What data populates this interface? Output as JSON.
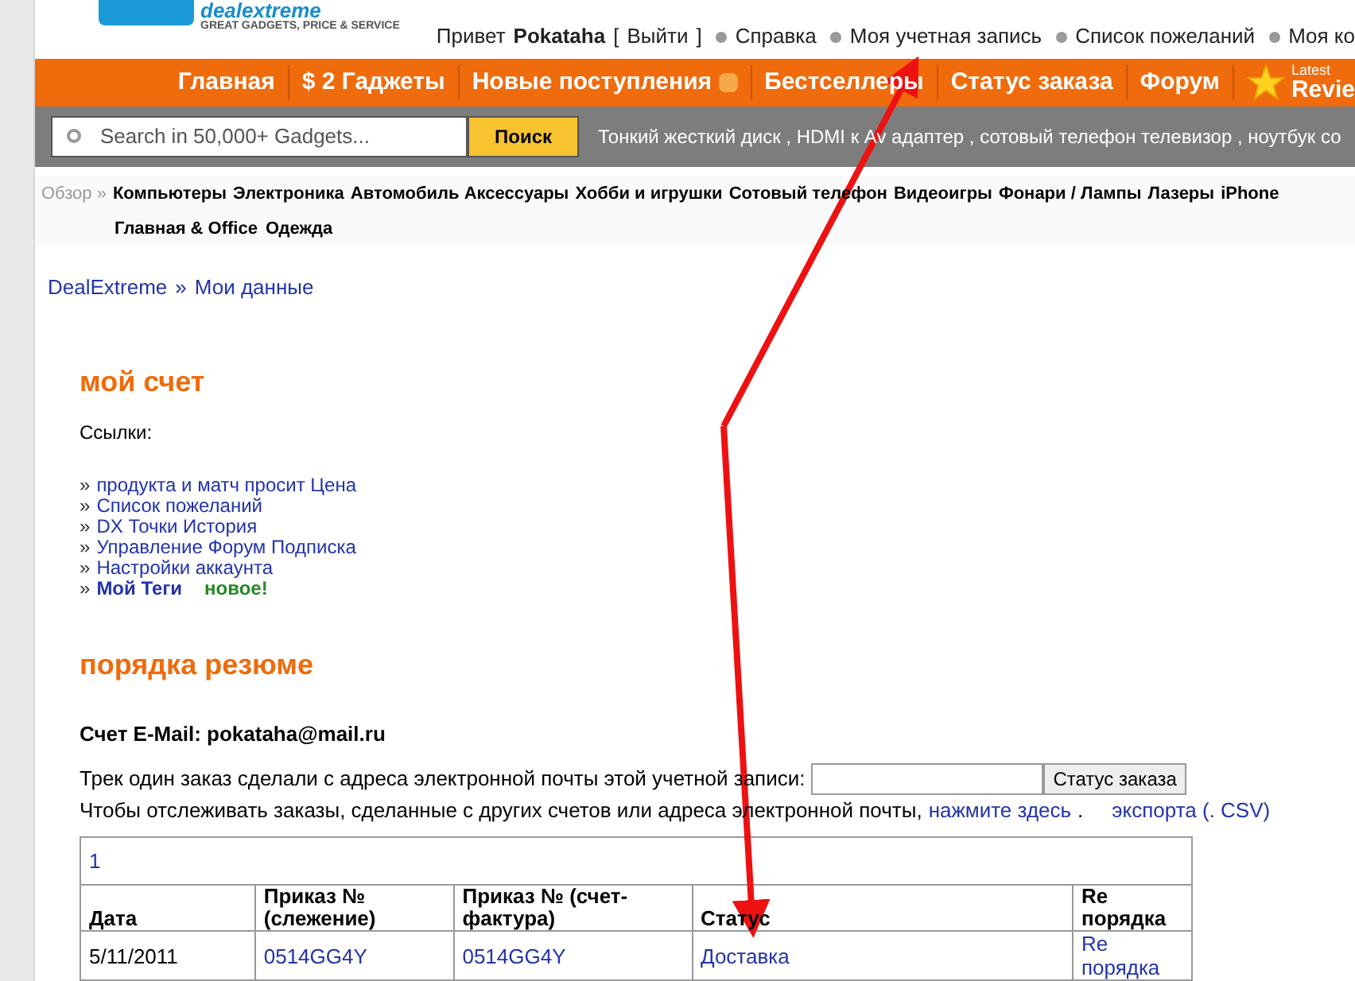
{
  "logo": {
    "brand": "dealextreme",
    "tagline": "GREAT GADGETS, PRICE & SERVICE"
  },
  "user_bar": {
    "greeting": "Привет",
    "username": "Pokataha",
    "logout_open": "[",
    "logout": "Выйти",
    "logout_close": "]",
    "links": [
      "Справка",
      "Моя учетная запись",
      "Список пожеланий",
      "Моя ко"
    ]
  },
  "nav": {
    "items": [
      {
        "label": "Главная",
        "kind": "text"
      },
      {
        "label": "$ 2 Гаджеты",
        "kind": "text"
      },
      {
        "label": "Новые поступления",
        "kind": "rss"
      },
      {
        "label": "Бестселлеры",
        "kind": "text"
      },
      {
        "label": "Статус заказа",
        "kind": "text"
      },
      {
        "label": "Форум",
        "kind": "text"
      }
    ],
    "reviews_top": "Latest",
    "reviews": "Revie"
  },
  "search": {
    "placeholder": "Search in 50,000+ Gadgets...",
    "button": "Поиск",
    "suggestions": "Тонкий жесткий диск , HDMI к Av адаптер , сотовый телефон телевизор , ноутбук со"
  },
  "categories": {
    "label": "Обзор »",
    "items": [
      "Компьютеры",
      "Электроника",
      "Автомобиль Аксессуары",
      "Хобби и игрушки",
      "Сотовый телефон",
      "Видеоигры",
      "Фонари / Лампы",
      "Лазеры",
      "iPhone",
      "Главная & Office",
      "Одежда"
    ]
  },
  "breadcrumb": [
    "DealExtreme",
    "»",
    "Мои данные"
  ],
  "account": {
    "title": "мой счет",
    "links_label": "Ссылки:",
    "links": [
      {
        "marker": "»",
        "label": "продукта и матч просит Цена",
        "bold": false
      },
      {
        "marker": "»",
        "label": "Список пожеланий",
        "bold": false
      },
      {
        "marker": "»",
        "label": "DX Точки История",
        "bold": false
      },
      {
        "marker": "»",
        "label": "Управление Форум Подписка",
        "bold": false
      },
      {
        "marker": "»",
        "label": "Настройки аккаунта",
        "bold": false
      },
      {
        "marker": "»",
        "label": "Мой Теги",
        "bold": true,
        "badge": "новое!"
      }
    ]
  },
  "orders": {
    "title": "порядка резюме",
    "email_label": "Счет E-Mail: pokataha@mail.ru",
    "track_text": "Трек один заказ сделали с адреса электронной почты этой учетной записи:",
    "track_button": "Статус заказа",
    "other_text": "Чтобы отслеживать заказы, сделанные с других счетов или адреса электронной почты,",
    "click_here": "нажмите здесь",
    "dot": ".",
    "export": "экспорта (. CSV)",
    "table": {
      "page": "1",
      "columns": [
        "Дата",
        "Приказ № (слежение)",
        "Приказ № (счет-фактура)",
        "Статус",
        "Re порядка"
      ],
      "rows": [
        [
          "5/11/2011",
          "0514GG4Y",
          "0514GG4Y",
          "Доставка",
          "Re порядка"
        ]
      ]
    }
  }
}
